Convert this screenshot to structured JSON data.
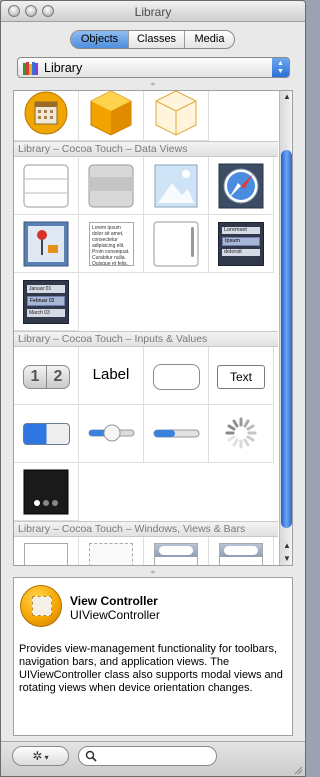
{
  "window": {
    "title": "Library"
  },
  "segments": [
    {
      "label": "Objects",
      "active": true
    },
    {
      "label": "Classes",
      "active": false
    },
    {
      "label": "Media",
      "active": false
    }
  ],
  "library_popup": {
    "label": "Library"
  },
  "sections": [
    {
      "header": "Library – Cocoa Touch – Data Views"
    },
    {
      "header": "Library – Cocoa Touch – Inputs & Values"
    },
    {
      "header": "Library – Cocoa Touch – Windows, Views & Bars"
    }
  ],
  "items": {
    "textview_text": "Lorem ipsum dolor sit amet, consectetur adipisicing elit. Proin consequat. Curabitur nulla. Quisque et felis.",
    "picker_top": "Loremset",
    "picker_mid1": "Ipsum",
    "picker_mid2": "dolorsit",
    "datepicker_rows": [
      "Januar 01",
      "Februar 02",
      "March 03"
    ],
    "segmented_labels": [
      "1",
      "2"
    ],
    "label_text": "Label",
    "textfield_text": "Text"
  },
  "selected_item": {
    "name": "View Controller",
    "class": "UIViewController",
    "description": "Provides view-management functionality for toolbars, navigation bars, and application views. The UIViewController class also supports modal views and rotating views when device orientation changes."
  },
  "bottom": {
    "action_icon": "gear-icon",
    "search_icon": "magnifier-icon",
    "search_placeholder": ""
  }
}
